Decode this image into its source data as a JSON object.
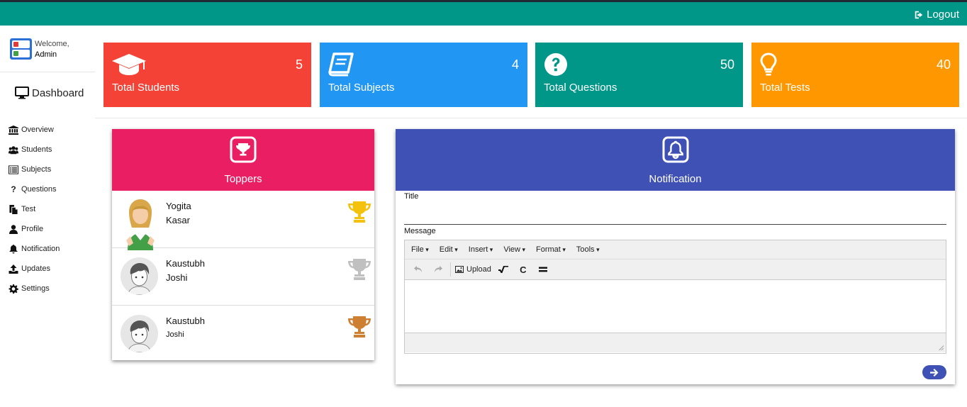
{
  "header": {
    "logout_label": "Logout"
  },
  "sidebar": {
    "welcome": "Welcome,",
    "user": "Admin",
    "dashboard_label": "Dashboard",
    "items": [
      {
        "label": "Overview",
        "icon": "bank-icon"
      },
      {
        "label": "Students",
        "icon": "users-icon"
      },
      {
        "label": "Subjects",
        "icon": "list-icon"
      },
      {
        "label": "Questions",
        "icon": "question-icon"
      },
      {
        "label": "Test",
        "icon": "copy-icon"
      },
      {
        "label": "Profile",
        "icon": "user-icon"
      },
      {
        "label": "Notification",
        "icon": "bell-icon"
      },
      {
        "label": "Updates",
        "icon": "upload-icon"
      },
      {
        "label": "Settings",
        "icon": "gear-icon"
      }
    ]
  },
  "stats": [
    {
      "label": "Total Students",
      "value": "5",
      "color": "#f44336",
      "icon": "graduation-cap-icon"
    },
    {
      "label": "Total Subjects",
      "value": "4",
      "color": "#2196f3",
      "icon": "book-icon"
    },
    {
      "label": "Total Questions",
      "value": "50",
      "color": "#009688",
      "icon": "question-circle-icon"
    },
    {
      "label": "Total Tests",
      "value": "40",
      "color": "#ff9800",
      "icon": "lightbulb-icon"
    }
  ],
  "toppers": {
    "title": "Toppers",
    "header_color": "#e91e63",
    "rows": [
      {
        "first": "Yogita",
        "last": "Kasar",
        "trophy_color": "#f4c20d"
      },
      {
        "first": "Kaustubh",
        "last": "Joshi",
        "trophy_color": "#c0c0c0"
      },
      {
        "first": "Kaustubh",
        "last": "Joshi",
        "trophy_color": "#cd7f32"
      }
    ]
  },
  "notification": {
    "title": "Notification",
    "header_color": "#3f51b5",
    "title_label": "Title",
    "title_value": "",
    "message_label": "Message",
    "menus": [
      "File",
      "Edit",
      "Insert",
      "View",
      "Format",
      "Tools"
    ],
    "upload_label": "Upload"
  }
}
